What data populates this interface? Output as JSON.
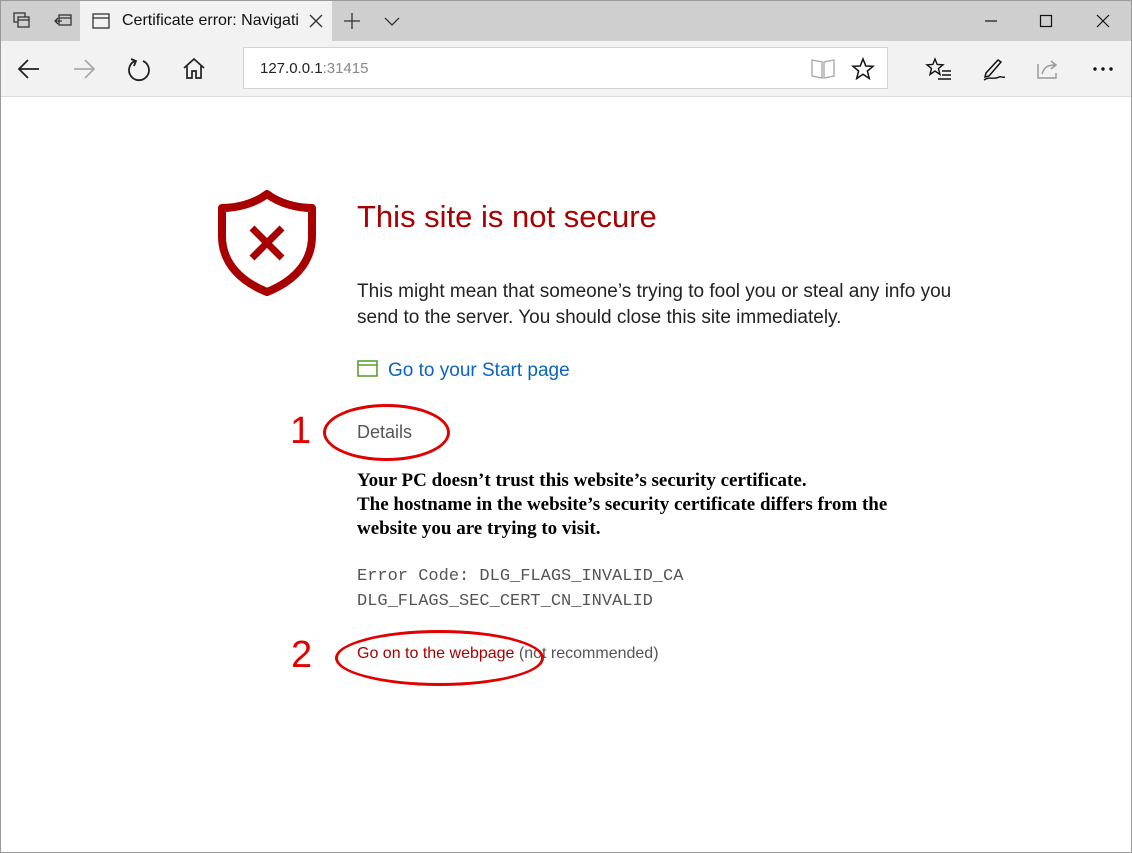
{
  "tab": {
    "title": "Certificate error: Navigation blocked"
  },
  "address": {
    "host": "127.0.0.1",
    "port": ":31415"
  },
  "page": {
    "heading": "This site is not secure",
    "description": "This might mean that someone’s trying to fool you or steal any info you send to the server. You should close this site immediately.",
    "start_link": "Go to your Start page",
    "details_label": "Details",
    "detail_lines": [
      "Your PC doesn’t trust this website’s security certificate.",
      "The hostname in the website’s security certificate differs from the",
      "website you are trying to visit."
    ],
    "error_code_lines": [
      "Error Code: DLG_FLAGS_INVALID_CA",
      "DLG_FLAGS_SEC_CERT_CN_INVALID"
    ],
    "go_on_link": "Go on to the webpage",
    "go_on_note": " (not recommended)"
  },
  "annotations": {
    "marker_1": "1",
    "marker_2": "2",
    "color": "#e00000"
  },
  "colors": {
    "accent_red": "#a80000",
    "link_blue": "#0b63c4"
  },
  "icons": [
    "set-aside-tabs-icon",
    "show-tabs-icon",
    "tab-page-icon",
    "close-tab-icon",
    "new-tab-icon",
    "tab-preview-icon",
    "minimize-icon",
    "maximize-icon",
    "close-window-icon",
    "back-icon",
    "forward-icon",
    "refresh-icon",
    "home-icon",
    "reading-view-icon",
    "favorite-star-icon",
    "favorites-hub-icon",
    "web-note-icon",
    "share-icon",
    "more-icon",
    "shield-error-icon",
    "start-page-icon"
  ]
}
